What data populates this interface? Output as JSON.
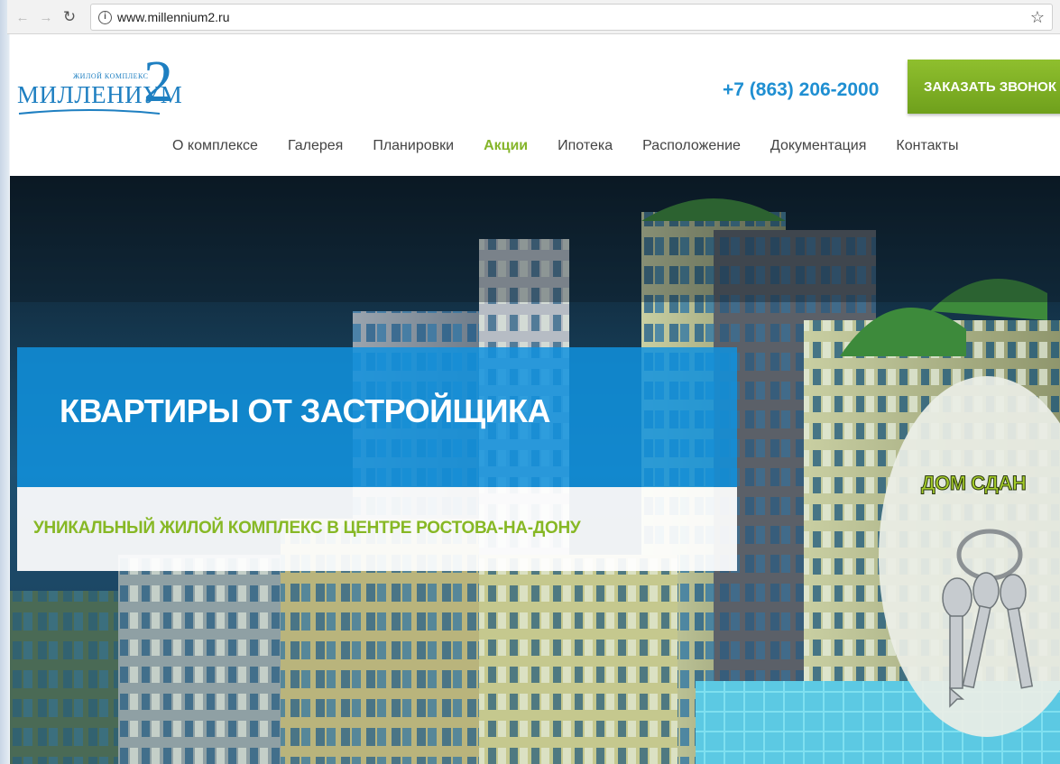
{
  "browser": {
    "url": "www.millennium2.ru"
  },
  "header": {
    "logo_small": "ЖИЛОЙ КОМПЛЕКС",
    "logo_main": "МИЛЛЕНИУМ",
    "logo_number": "2",
    "phone": "+7 (863) 206-2000",
    "callback_button": "ЗАКАЗАТЬ ЗВОНОК"
  },
  "menu": {
    "items": [
      {
        "label": "О комплексе"
      },
      {
        "label": "Галерея"
      },
      {
        "label": "Планировки"
      },
      {
        "label": "Акции",
        "active": true
      },
      {
        "label": "Ипотека"
      },
      {
        "label": "Расположение"
      },
      {
        "label": "Документация"
      },
      {
        "label": "Контакты"
      }
    ]
  },
  "hero": {
    "title": "КВАРТИРЫ ОТ ЗАСТРОЙЩИКА",
    "subtitle": "УНИКАЛЬНЫЙ ЖИЛОЙ КОМПЛЕКС В ЦЕНТРЕ РОСТОВА-НА-ДОНУ",
    "badge": "ДОМ СДАН",
    "badge_icon": "keys-icon"
  },
  "colors": {
    "accent_green": "#85b52a",
    "accent_blue": "#1f8fd2"
  }
}
